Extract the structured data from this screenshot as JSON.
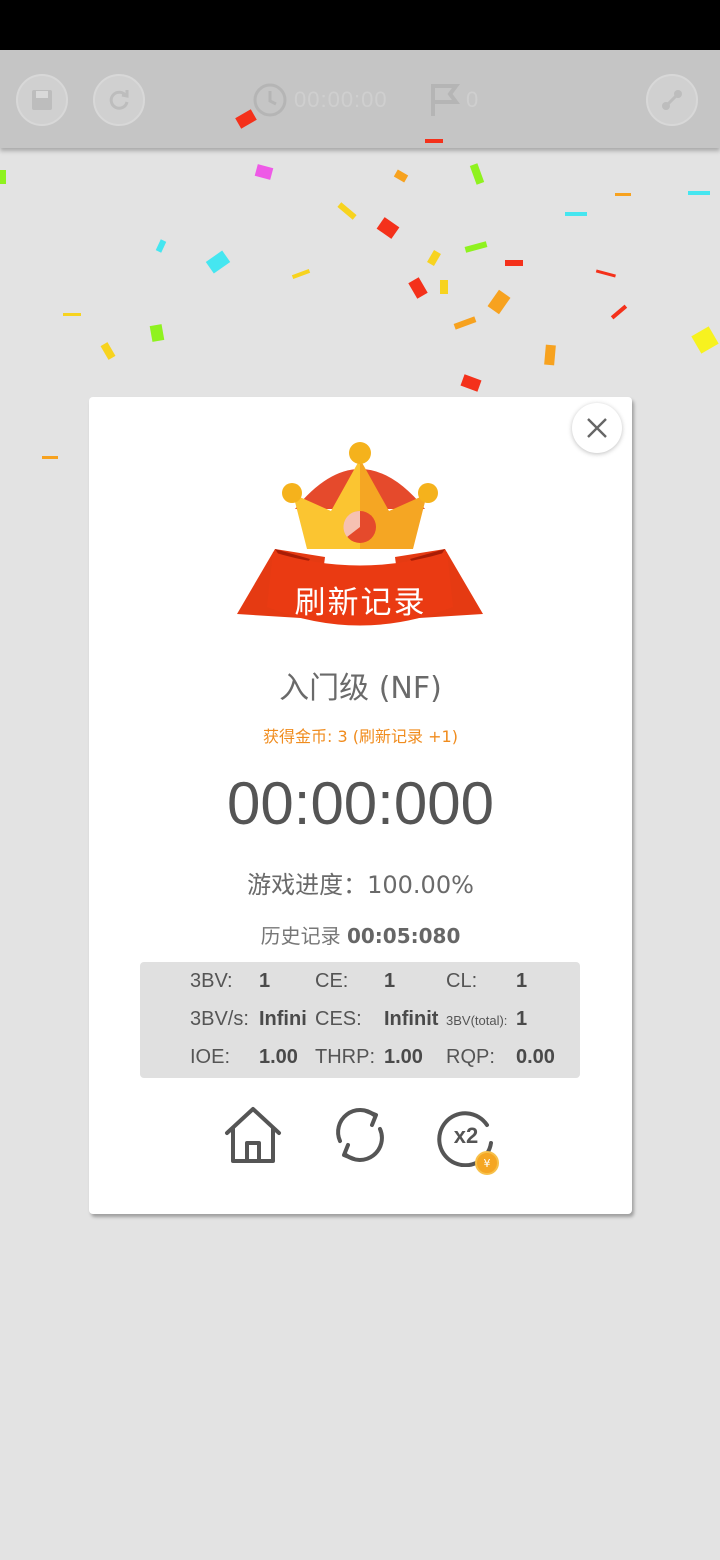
{
  "toolbar": {
    "timer": "00:00:00",
    "flags": "0"
  },
  "result": {
    "banner": "刷新记录",
    "level": "入门级 (NF)",
    "coins": "获得金币: 3 (刷新记录 +1)",
    "time": "00:00:000",
    "progress": "游戏进度：100.00%",
    "history_label": "历史记录",
    "history_value": "00:05:080"
  },
  "stats": {
    "bbbv_label": "3BV:",
    "bbbv_value": "1",
    "ce_label": "CE:",
    "ce_value": "1",
    "cl_label": "CL:",
    "cl_value": "1",
    "bbbvs_label": "3BV/s:",
    "bbbvs_value": "Infini",
    "ces_label": "CES:",
    "ces_value": "Infinit",
    "bbbv_total_label": "3BV(total):",
    "bbbv_total_value": "1",
    "ioe_label": "IOE:",
    "ioe_value": "1.00",
    "thrp_label": "THRP:",
    "thrp_value": "1.00",
    "rqp_label": "RQP:",
    "rqp_value": "0.00"
  },
  "actions": {
    "double_label": "x2",
    "coin_symbol": "¥"
  },
  "colors": {
    "accent_orange": "#f08c1e",
    "banner_red": "#e53a12",
    "crown_yellow": "#fbc531"
  }
}
